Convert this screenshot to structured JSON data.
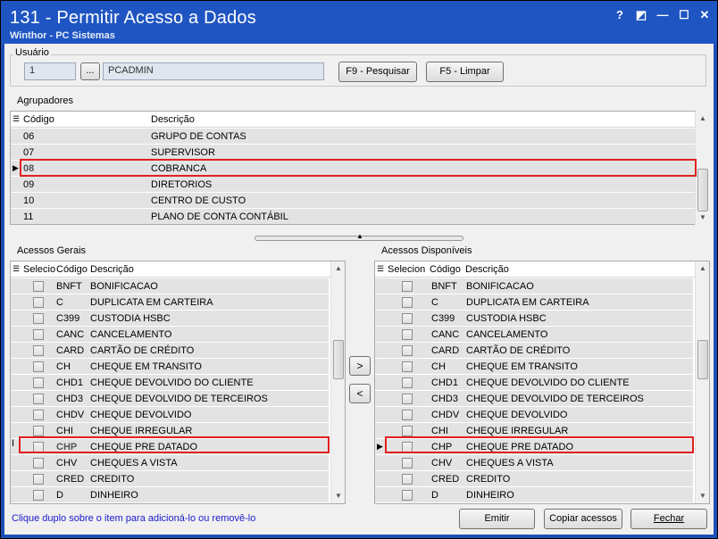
{
  "window": {
    "title": "131 - Permitir Acesso a Dados",
    "subtitle": "Winthor - PC Sistemas",
    "controls": [
      "?",
      "◩",
      "—",
      "☐",
      "✕"
    ]
  },
  "usuario": {
    "group_label": "Usuário",
    "code": "1",
    "lookup_label": "...",
    "name": "PCADMIN",
    "search_label": "F9 - Pesquisar",
    "clear_label": "F5 - Limpar"
  },
  "agrupadores": {
    "group_label": "Agrupadores",
    "headers": {
      "code": "Código",
      "desc": "Descrição"
    },
    "rows": [
      {
        "code": "06",
        "desc": "GRUPO DE CONTAS"
      },
      {
        "code": "07",
        "desc": "SUPERVISOR"
      },
      {
        "code": "08",
        "desc": "COBRANCA"
      },
      {
        "code": "09",
        "desc": "DIRETORIOS"
      },
      {
        "code": "10",
        "desc": "CENTRO DE CUSTO"
      },
      {
        "code": "11",
        "desc": "PLANO DE CONTA CONTÁBIL"
      }
    ],
    "selected_index": 2
  },
  "acessos_gerais": {
    "group_label": "Acessos Gerais",
    "headers": {
      "sel": "Selecio",
      "code": "Código",
      "desc": "Descrição"
    },
    "selected_index": 10
  },
  "acessos_disponiveis": {
    "group_label": "Acessos Disponíveis",
    "headers": {
      "sel": "Seleciona",
      "code": "Código",
      "desc": "Descrição"
    },
    "selected_index": 10
  },
  "access_rows": [
    {
      "code": "BNFT",
      "desc": "BONIFICACAO"
    },
    {
      "code": "C",
      "desc": "DUPLICATA EM CARTEIRA"
    },
    {
      "code": "C399",
      "desc": "CUSTODIA HSBC"
    },
    {
      "code": "CANC",
      "desc": "CANCELAMENTO"
    },
    {
      "code": "CARD",
      "desc": "CARTÃO DE CRÉDITO"
    },
    {
      "code": "CH",
      "desc": "CHEQUE EM TRANSITO"
    },
    {
      "code": "CHD1",
      "desc": "CHEQUE DEVOLVIDO DO CLIENTE"
    },
    {
      "code": "CHD3",
      "desc": "CHEQUE DEVOLVIDO DE TERCEIROS"
    },
    {
      "code": "CHDV",
      "desc": "CHEQUE DEVOLVIDO"
    },
    {
      "code": "CHI",
      "desc": "CHEQUE IRREGULAR"
    },
    {
      "code": "CHP",
      "desc": "CHEQUE PRE DATADO"
    },
    {
      "code": "CHV",
      "desc": "CHEQUES A VISTA"
    },
    {
      "code": "CRED",
      "desc": "CREDITO"
    },
    {
      "code": "D",
      "desc": "DINHEIRO"
    }
  ],
  "move": {
    "right": ">",
    "left": "<"
  },
  "footer": {
    "hint": "Clique duplo sobre o item para adicioná-lo ou removê-lo",
    "emit_label": "Emitir",
    "copy_label": "Copiar acessos",
    "close_label": "Fechar"
  },
  "colors": {
    "titlebar": "#1f55c2",
    "highlight": "#e02020",
    "hint": "#1a1acc"
  }
}
